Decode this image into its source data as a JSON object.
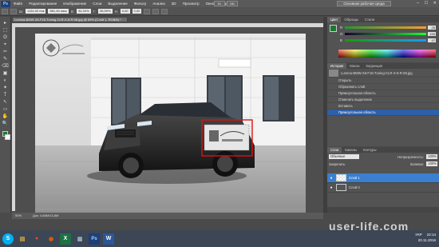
{
  "app": {
    "logo": "Ps"
  },
  "menu": [
    "Файл",
    "Редактирование",
    "Изображение",
    "Слои",
    "Выделение",
    "Фильтр",
    "Анализ",
    "3D",
    "Просмотр",
    "Окно",
    "Справка"
  ],
  "workspace_button": "Основная рабочая среда",
  "top_small_buttons": [
    "Br",
    "Mb"
  ],
  "window_controls": [
    "–",
    "☐",
    "✕"
  ],
  "options_bar": {
    "fields": [
      "1134,00 пик",
      "581,46 пикс",
      "34,34%",
      "36,59%",
      "0,00",
      "0,00"
    ],
    "labels": [
      "Ш:",
      "В:",
      "Г:",
      "Н:"
    ]
  },
  "tools": [
    "▸",
    "⬚",
    "ʘ",
    "⌖",
    "✂",
    "✎",
    "⌫",
    "▣",
    "◐",
    "✦",
    "T",
    "↖",
    "▭",
    "✋",
    "🔍"
  ],
  "document": {
    "tab": "Lumma-BMW-X6-F16-Tuning-CLR-X-6-R-08.jpg @ 50% (Слой 1, RGB/8) *",
    "status": [
      "50%",
      "Док: 4,88М/13,8М"
    ]
  },
  "color_panel": {
    "tabs": [
      "Цвет",
      "Образцы",
      "Стили"
    ],
    "sliders": [
      {
        "label": "R",
        "value": "25"
      },
      {
        "label": "G",
        "value": "155"
      },
      {
        "label": "B",
        "value": "47"
      }
    ]
  },
  "history_panel": {
    "tabs": [
      "История",
      "Маска",
      "Коррекция"
    ],
    "snapshot": "Lumma-BMW-X6-F16-Tuning-CLR-X-6-R-08.jpg",
    "items": [
      "Открыть",
      "Образовать слой",
      "Прямоугольная область",
      "Отменить выделение",
      "Вставить",
      "Прямоугольная область"
    ],
    "selected_index": 5
  },
  "layers_panel": {
    "tabs": [
      "Слои",
      "Каналы",
      "Контуры"
    ],
    "blend_mode": "Обычные",
    "opacity_label": "Непрозрачность:",
    "opacity": "100%",
    "lock_label": "Закрепить:",
    "fill_label": "Заливка:",
    "fill": "100%",
    "layers": [
      {
        "name": "Слой 1",
        "selected": true
      },
      {
        "name": "Слой 0",
        "selected": false
      }
    ]
  },
  "taskbar": {
    "apps": [
      {
        "name": "skype",
        "glyph": "S",
        "color": "#00aff0"
      },
      {
        "name": "explorer",
        "glyph": "▤",
        "color": "#e0b040"
      },
      {
        "name": "chrome",
        "glyph": "●",
        "color": "#dd4b39"
      },
      {
        "name": "firefox",
        "glyph": "◉",
        "color": "#e66000"
      },
      {
        "name": "excel",
        "glyph": "X",
        "color": "#1e7145"
      },
      {
        "name": "viewer",
        "glyph": "▦",
        "color": "#5a6a80"
      },
      {
        "name": "photoshop",
        "glyph": "Ps",
        "color": "#1e3f7a"
      },
      {
        "name": "word",
        "glyph": "W",
        "color": "#2b579a"
      }
    ],
    "language": "УКР",
    "time": "22:14",
    "date": "20.11.2016"
  },
  "watermark": "user-life.com",
  "colors": {
    "foreground": "#1a7a2c",
    "selection_box": "#e01010",
    "layer_selected": "#3a7fd0"
  }
}
